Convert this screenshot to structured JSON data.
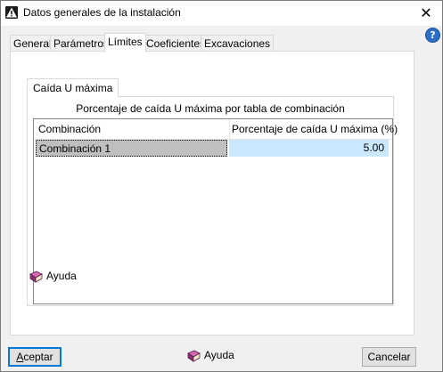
{
  "window": {
    "title": "Datos generales de la instalación",
    "close_glyph": "✕",
    "help_glyph": "?"
  },
  "tabs": [
    {
      "label": "General",
      "active": false
    },
    {
      "label": "Parámetros",
      "active": false
    },
    {
      "label": "Límites",
      "active": true
    },
    {
      "label": "Coeficientes",
      "active": false
    },
    {
      "label": "Excavaciones",
      "active": false
    }
  ],
  "limits": {
    "inner_tab": "Caída U máxima",
    "caption": "Porcentaje de caída U máxima por tabla de combinación",
    "columns": [
      "Combinación",
      "Porcentaje de caída U máxima (%)"
    ],
    "rows": [
      {
        "combination": "Combinación 1",
        "percent": "5.00",
        "selected": true
      }
    ],
    "help_label": "Ayuda"
  },
  "footer": {
    "accept_first": "A",
    "accept_rest": "ceptar",
    "help_label": "Ayuda",
    "cancel_label": "Cancelar"
  },
  "icons": {
    "title_icon": "warning-triangle-icon",
    "help_book": "book-icon",
    "help_circle": "question-icon"
  }
}
